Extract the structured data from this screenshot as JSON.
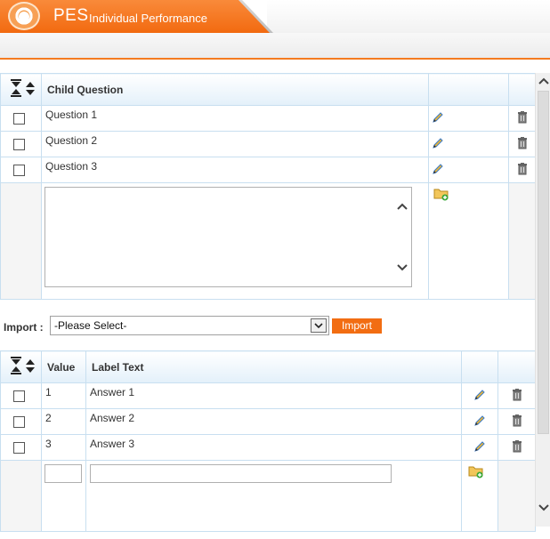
{
  "header": {
    "app_title": "PES",
    "app_subtitle": "Individual Performance"
  },
  "child_question_table": {
    "header": "Child Question",
    "rows": [
      {
        "text": "Question 1"
      },
      {
        "text": "Question 2"
      },
      {
        "text": "Question 3"
      }
    ]
  },
  "import": {
    "label": "Import :",
    "selected": "-Please Select-",
    "button": "Import"
  },
  "answer_table": {
    "headers": {
      "value": "Value",
      "label": "Label Text"
    },
    "rows": [
      {
        "value": "1",
        "label": "Answer 1"
      },
      {
        "value": "2",
        "label": "Answer 2"
      },
      {
        "value": "3",
        "label": "Answer 3"
      }
    ]
  },
  "colors": {
    "accent": "#f26d12",
    "grid_border": "#c8dff0",
    "header_bg": "#e3f0fa"
  },
  "icons": {
    "sort": "expand-collapse-icon",
    "edit": "pencil-icon",
    "delete": "trash-icon",
    "add": "folder-add-icon"
  }
}
